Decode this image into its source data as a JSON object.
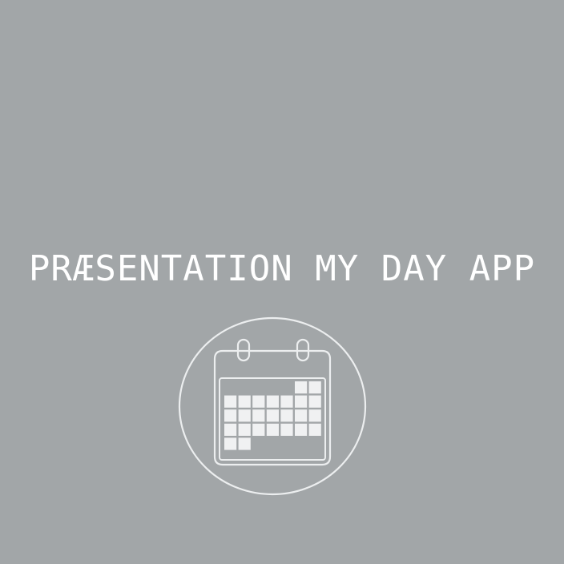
{
  "title": "PRÆSENTATION MY DAY APP",
  "icon": "calendar-icon",
  "colors": {
    "background": "#a2a6a8",
    "foreground": "#ffffff",
    "outline": "#eceeef",
    "cell": "#f0f1f2"
  }
}
